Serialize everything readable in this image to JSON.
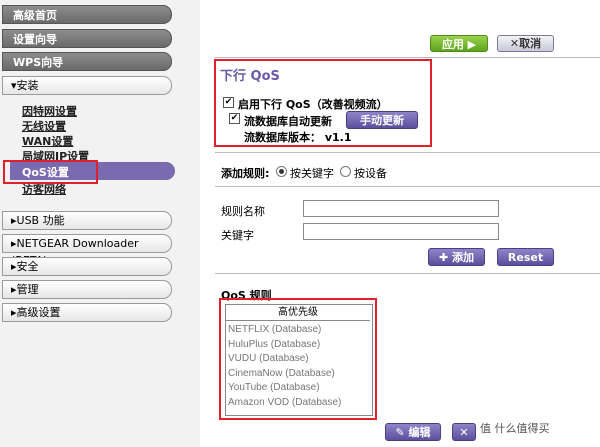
{
  "sidebar": {
    "top_items": [
      "高级首页",
      "设置向导",
      "WPS向导"
    ],
    "install_section": "▾安装",
    "sub_items": [
      "因特网设置",
      "无线设置",
      "WAN设置",
      "局域网IP设置",
      "QoS设置",
      "访客网络"
    ],
    "bottom_items": [
      "▸USB 功能",
      "▸NETGEAR Downloader (BETA)",
      "▸安全",
      "▸管理",
      "▸高级设置"
    ]
  },
  "toolbar": {
    "apply_label": "应用 ▶",
    "cancel_label": "✕取消"
  },
  "qos": {
    "title": "下行 QoS",
    "enable_label": "启用下行 QoS（改善视频流）",
    "auto_update_label": "流数据库自动更新",
    "manual_update_label": "手动更新",
    "db_version_label": "流数据库版本： v1.1"
  },
  "add_rule": {
    "label": "添加规则:",
    "option_keyword": "按关键字",
    "option_device": "按设备",
    "rule_name_label": "规则名称",
    "keyword_label": "关键字",
    "add_button": "✚ 添加",
    "reset_button": "Reset"
  },
  "rules": {
    "section_title": "QoS 规则",
    "header": "高优先级",
    "items": [
      "NETFLIX (Database)",
      "HuluPlus (Database)",
      "VUDU (Database)",
      "CinemaNow (Database)",
      "YouTube (Database)",
      "Amazon VOD (Database)"
    ],
    "edit_button": "✎ 编辑",
    "delete_button": "✕"
  },
  "watermark": "值 什么值得买",
  "colors": {
    "accent_purple": "#6a5aa8",
    "apply_green": "#5da31b",
    "highlight_red": "#e0202a"
  }
}
